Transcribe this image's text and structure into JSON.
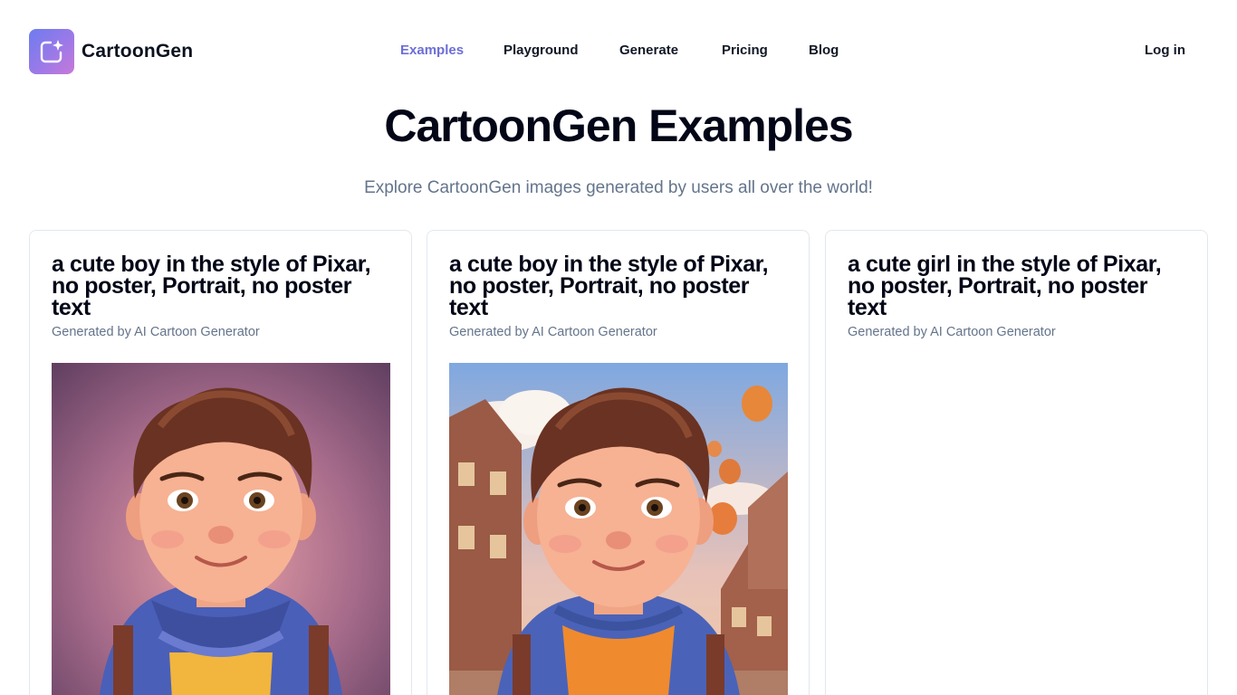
{
  "brand": {
    "name": "CartoonGen",
    "logo_icon": "sparkle-frame-icon"
  },
  "nav": {
    "items": [
      {
        "label": "Examples",
        "active": true
      },
      {
        "label": "Playground",
        "active": false
      },
      {
        "label": "Generate",
        "active": false
      },
      {
        "label": "Pricing",
        "active": false
      },
      {
        "label": "Blog",
        "active": false
      }
    ],
    "login_label": "Log in"
  },
  "hero": {
    "title": "CartoonGen Examples",
    "subtitle": "Explore CartoonGen images generated by users all over the world!"
  },
  "cards": [
    {
      "title": "a cute boy in the style of Pixar, no poster, Portrait, no poster text",
      "subtitle": "Generated by AI Cartoon Generator"
    },
    {
      "title": "a cute boy in the style of Pixar, no poster, Portrait, no poster text",
      "subtitle": "Generated by AI Cartoon Generator"
    },
    {
      "title": "a cute girl in the style of Pixar, no poster, Portrait, no poster text",
      "subtitle": "Generated by AI Cartoon Generator"
    }
  ],
  "colors": {
    "accent": "#6c6ed6",
    "text": "#0f172a",
    "muted": "#64748b",
    "border": "#e2e8f0"
  }
}
